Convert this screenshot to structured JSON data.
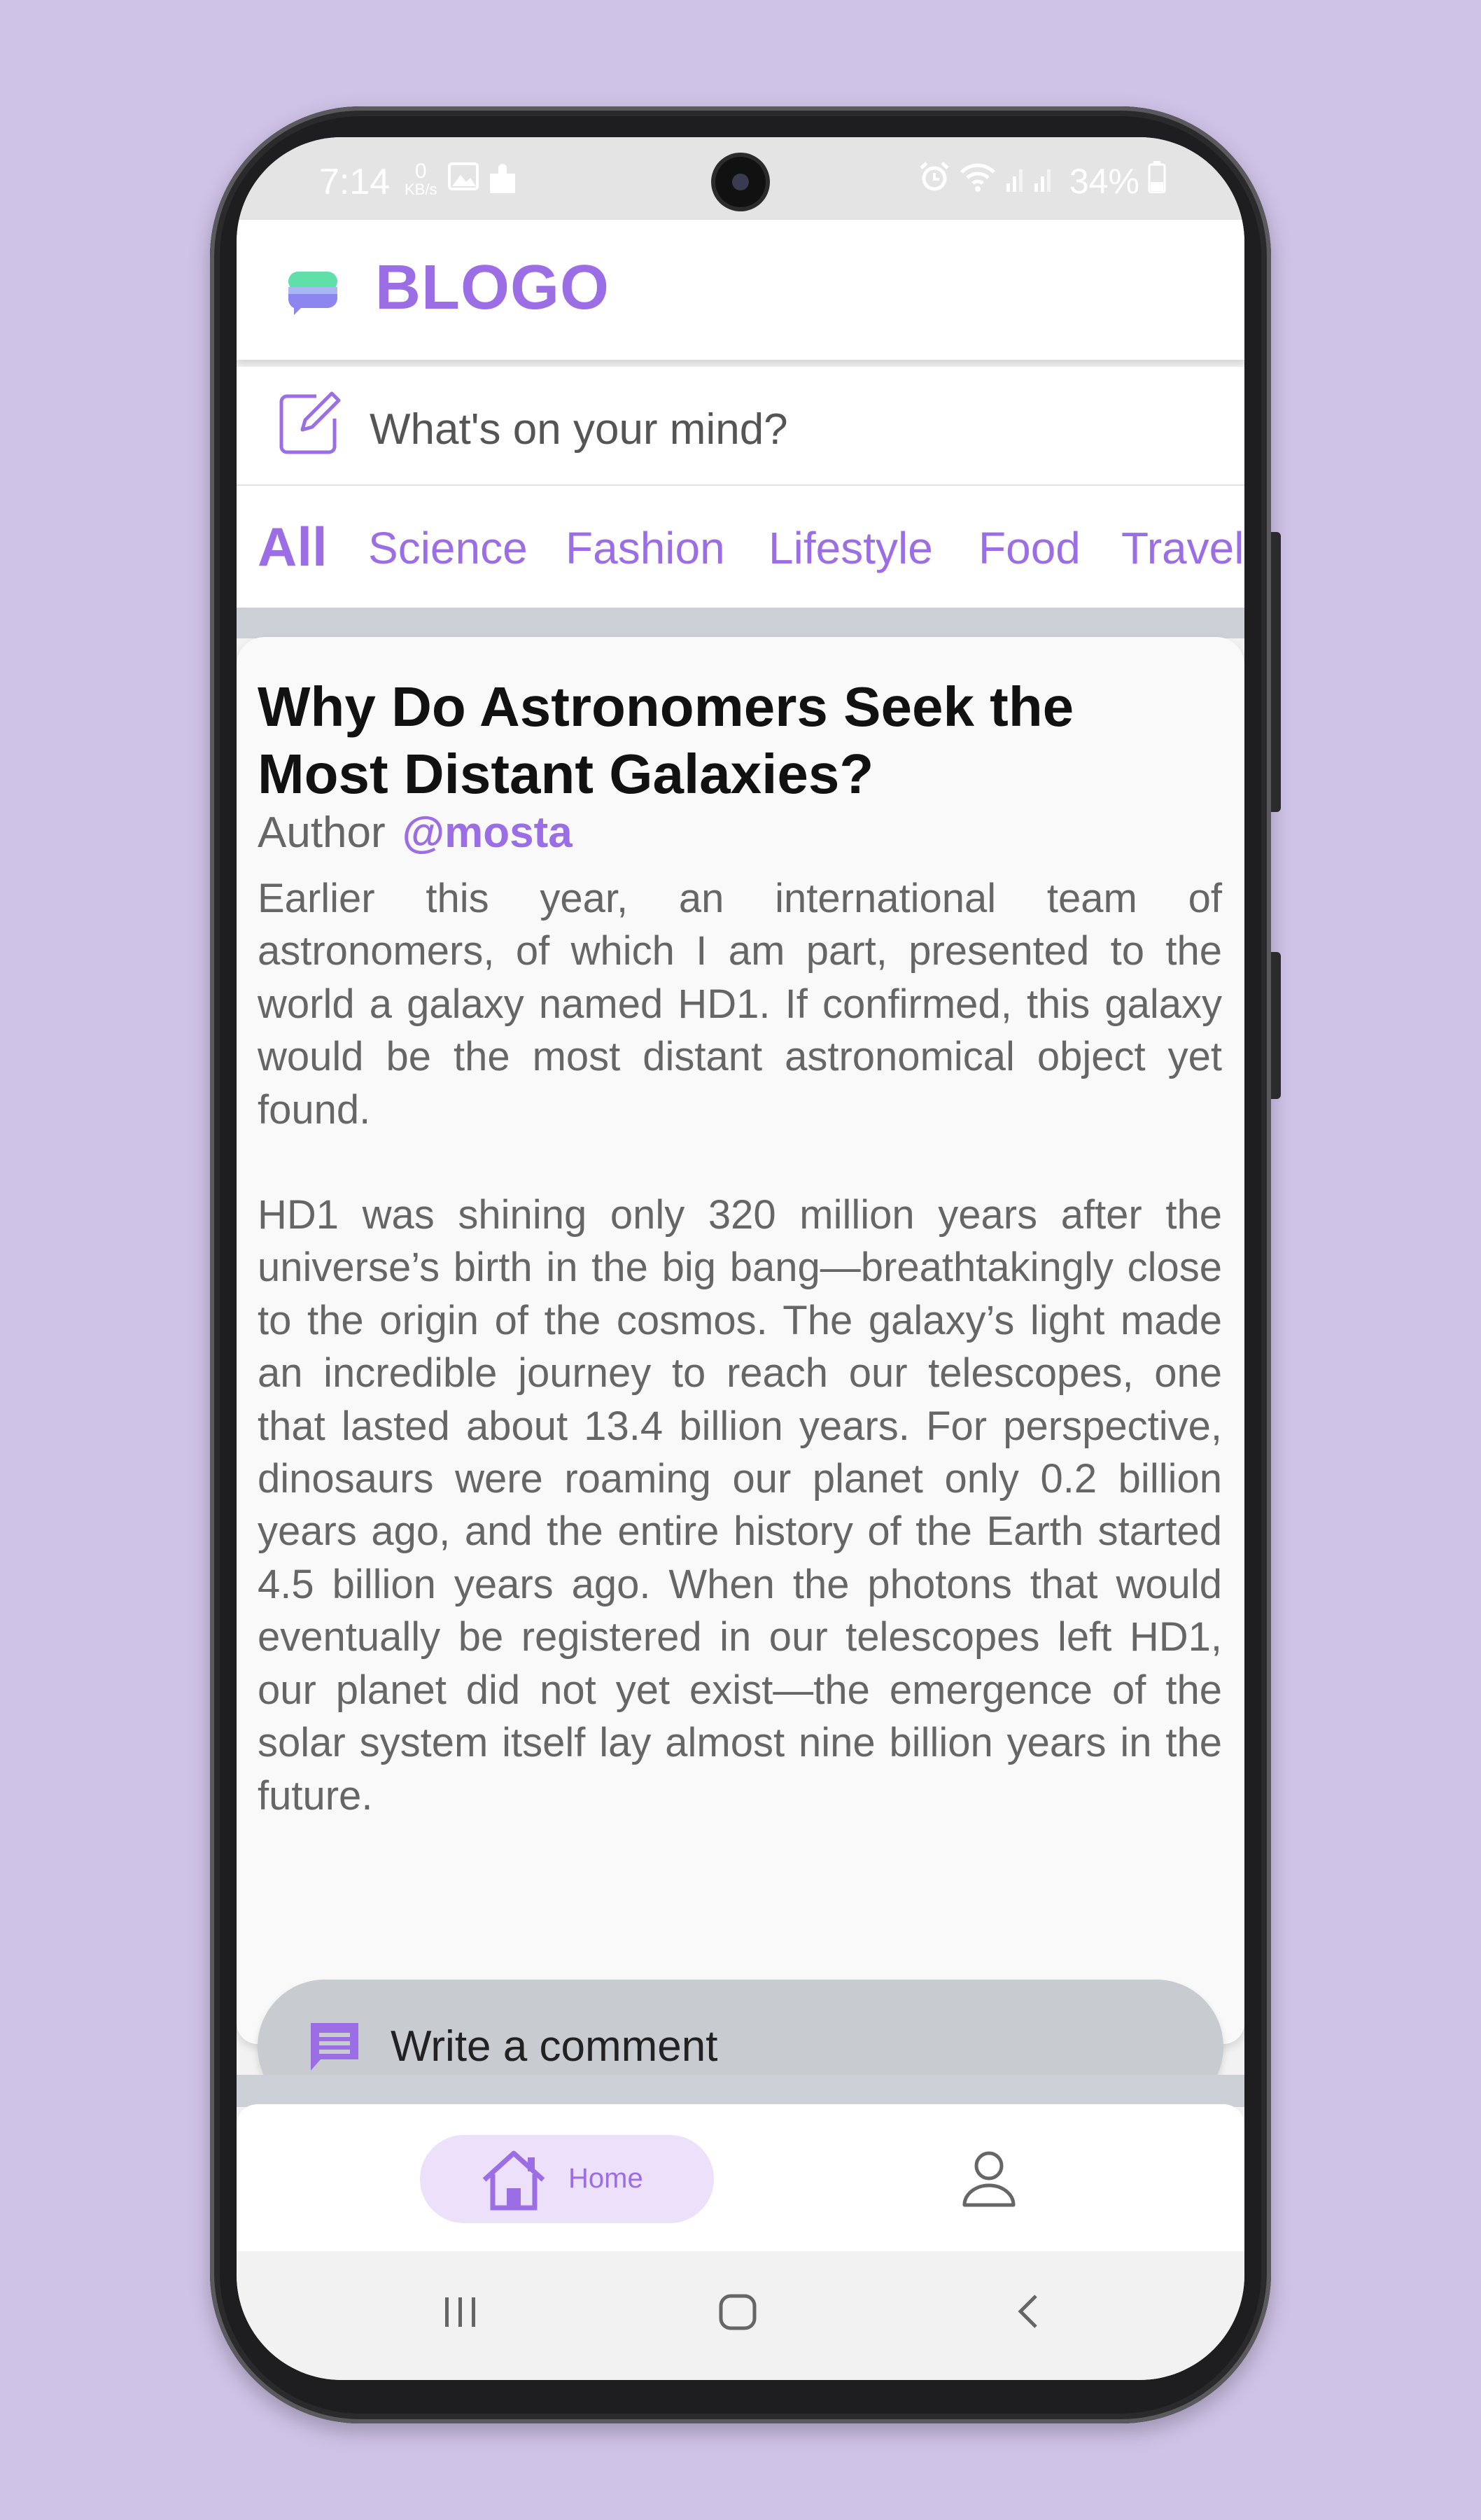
{
  "status_bar": {
    "time": "7:14",
    "net_speed_value": "0",
    "net_speed_unit": "KB/s",
    "battery": "34%"
  },
  "app": {
    "brand": "BLOGO",
    "accent_color": "#9c6ee5"
  },
  "compose": {
    "placeholder": "What's on your mind?"
  },
  "categories": {
    "items": [
      "All",
      "Science",
      "Fashion",
      "Lifestyle",
      "Food",
      "Travel"
    ],
    "active": "All"
  },
  "post": {
    "title": "Why Do Astronomers Seek the Most Distant Galaxies?",
    "author_label": "Author",
    "author_handle": "@mosta",
    "paragraphs": [
      "Earlier this year, an international team of astronomers, of which I am part, presented to the world a galaxy named HD1. If confirmed, this galaxy would be the most distant astronomical object yet found.",
      "HD1 was shining only 320 million years after the universe’s birth in the big bang—breathtakingly close to the origin of the cosmos. The galaxy’s light made an incredible journey to reach our telescopes, one that lasted about 13.4 billion years. For perspective, dinosaurs were roaming our planet only 0.2 billion years ago, and the entire history of the Earth started 4.5 billion years ago. When the photons that would eventually be registered in our telescopes left HD1, our planet did not yet exist—the emergence of the solar system itself lay almost nine billion years in the future."
    ],
    "comment_label": "Write a comment"
  },
  "bottom_nav": {
    "home_label": "Home"
  }
}
